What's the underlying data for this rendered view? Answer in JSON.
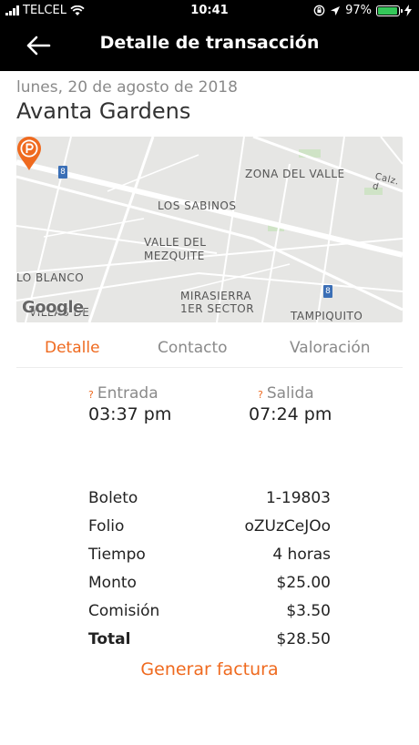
{
  "status_bar": {
    "carrier": "TELCEL",
    "time": "10:41",
    "battery_text": "97%",
    "battery_level": 0.97,
    "battery_color": "#34c759"
  },
  "header": {
    "title": "Detalle de transacción",
    "back_icon": "arrow-left-icon"
  },
  "place": {
    "date": "lunes, 20 de agosto de 2018",
    "name": "Avanta Gardens"
  },
  "map": {
    "labels": {
      "zona_del_valle": "ZONA DEL VALLE",
      "los_sabinos": "LOS SABINOS",
      "valle_del": "VALLE DEL",
      "mezquite": "MEZQUITE",
      "lo_blanco": "LO BLANCO",
      "villas_de": "VILLAS DE",
      "mirasierra": "MIRASIERRA",
      "primer_sector": "1ER SECTOR",
      "tampiquito": "TAMPIQUITO",
      "calz": "Calz. d"
    },
    "road_number_1": "8",
    "road_number_2": "8",
    "attribution": "Google",
    "pin_icon": "parking-pin-icon",
    "pin_color": "#ef6a1f"
  },
  "tabs": [
    {
      "label": "Detalle",
      "active": true
    },
    {
      "label": "Contacto",
      "active": false
    },
    {
      "label": "Valoración",
      "active": false
    }
  ],
  "entry": {
    "marker": "?",
    "label": "Entrada",
    "time": "03:37 pm"
  },
  "exit": {
    "marker": "?",
    "label": "Salida",
    "time": "07:24 pm"
  },
  "details": [
    {
      "label": "Boleto",
      "value": "1-19803"
    },
    {
      "label": "Folio",
      "value": "oZUzCeJOo"
    },
    {
      "label": "Tiempo",
      "value": "4 horas"
    },
    {
      "label": "Monto",
      "value": "$25.00"
    },
    {
      "label": "Comisión",
      "value": "$3.50"
    },
    {
      "label": "Total",
      "value": "$28.50"
    }
  ],
  "invoice_button": "Generar factura",
  "accent_color": "#ef6a1f"
}
